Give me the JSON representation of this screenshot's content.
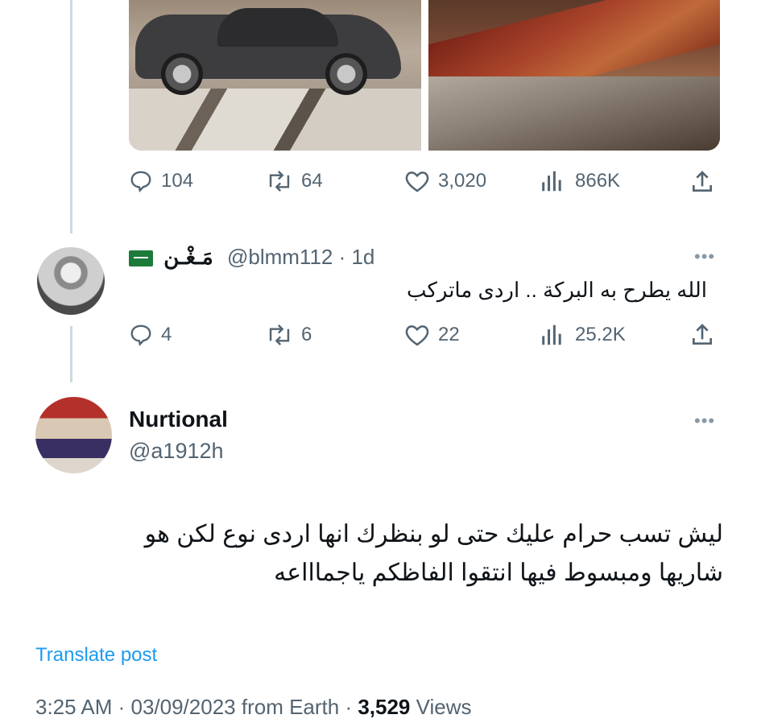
{
  "quoted_post": {
    "actions": {
      "replies": "104",
      "reposts": "64",
      "likes": "3,020",
      "views": "866K"
    }
  },
  "reply": {
    "display_name": "مَـغْـن",
    "handle_time": "@blmm112 · 1d",
    "text": "الله يطرح به البركة .. اردى ماتركب",
    "actions": {
      "replies": "4",
      "reposts": "6",
      "likes": "22",
      "views": "25.2K"
    }
  },
  "main_post": {
    "display_name": "Nurtional",
    "handle": "@a1912h",
    "text_line1": "ليش تسب حرام عليك حتى لو بنظرك انها اردى نوع لكن هو",
    "text_line2": "شاريها ومبسوط فيها انتقوا الفاظكم ياجماااعه",
    "translate_label": "Translate post",
    "timestamp": "3:25 AM · 03/09/2023 from Earth · ",
    "views_count": "3,529",
    "views_label": " Views"
  },
  "colors": {
    "text": "#0f1419",
    "secondary": "#536471",
    "link": "#1d9bf0",
    "thread_line": "#cfd9de"
  },
  "icons": [
    "reply-icon",
    "repost-icon",
    "like-icon",
    "views-icon",
    "share-icon",
    "more-icon",
    "flag-icon"
  ]
}
